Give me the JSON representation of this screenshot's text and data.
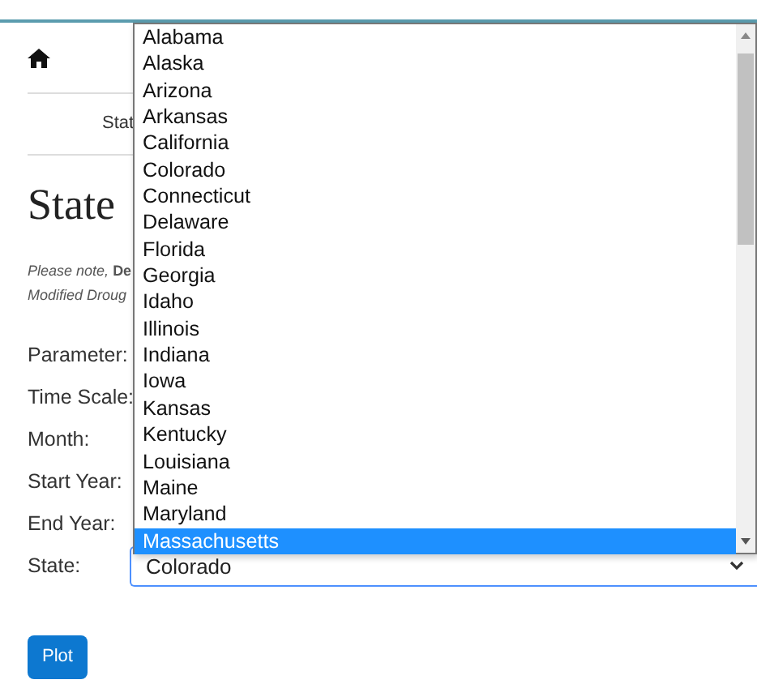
{
  "breadcrumb": "Stat",
  "heading": "State",
  "note": {
    "line_1": "*Please note,* **De**",
    "line_2": "Modified Droug"
  },
  "form": {
    "labels": [
      "Parameter:",
      "Time Scale:",
      "Month:",
      "Start Year:",
      "End Year:",
      "State:"
    ],
    "state_value": "Colorado"
  },
  "dropdown": {
    "options": [
      {
        "label": "Alabama",
        "selected": false
      },
      {
        "label": "Alaska",
        "selected": false
      },
      {
        "label": "Arizona",
        "selected": false
      },
      {
        "label": "Arkansas",
        "selected": false
      },
      {
        "label": "California",
        "selected": false
      },
      {
        "label": "Colorado",
        "selected": false
      },
      {
        "label": "Connecticut",
        "selected": false
      },
      {
        "label": "Delaware",
        "selected": false
      },
      {
        "label": "Florida",
        "selected": false
      },
      {
        "label": "Georgia",
        "selected": false
      },
      {
        "label": "Idaho",
        "selected": false
      },
      {
        "label": "Illinois",
        "selected": false
      },
      {
        "label": "Indiana",
        "selected": false
      },
      {
        "label": "Iowa",
        "selected": false
      },
      {
        "label": "Kansas",
        "selected": false
      },
      {
        "label": "Kentucky",
        "selected": false
      },
      {
        "label": "Louisiana",
        "selected": false
      },
      {
        "label": "Maine",
        "selected": false
      },
      {
        "label": "Maryland",
        "selected": false
      },
      {
        "label": "Massachusetts",
        "selected": true
      }
    ]
  },
  "button": "Plot"
}
